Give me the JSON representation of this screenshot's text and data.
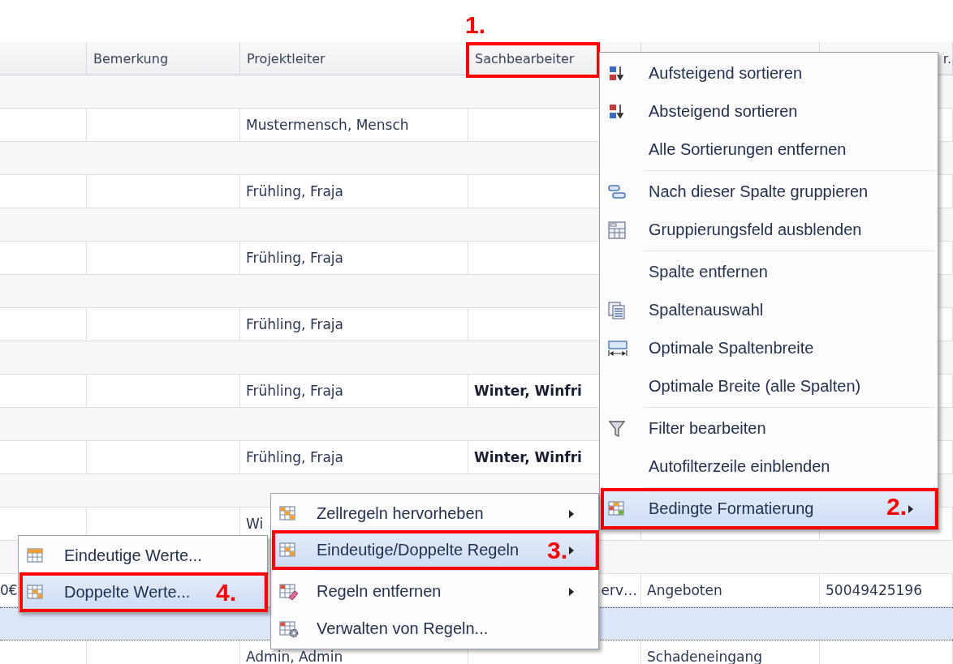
{
  "grid": {
    "columns": [
      {},
      {
        "label": "Bemerkung"
      },
      {
        "label": "Projektleiter"
      },
      {
        "label": "Sachbearbeiter",
        "annotation": "1."
      },
      {},
      {
        "label": "r."
      }
    ],
    "rows": [
      {
        "kind": "group",
        "selected": false
      },
      {
        "kind": "data",
        "selected": false,
        "cells": [
          null,
          null,
          {
            "text": "Mustermensch, Mensch",
            "bold": false
          },
          null,
          null,
          null
        ]
      },
      {
        "kind": "group",
        "selected": false
      },
      {
        "kind": "data",
        "selected": false,
        "cells": [
          null,
          null,
          {
            "text": "Frühling, Fraja",
            "bold": false
          },
          null,
          null,
          null
        ]
      },
      {
        "kind": "group",
        "selected": false
      },
      {
        "kind": "data",
        "selected": false,
        "cells": [
          null,
          null,
          {
            "text": "Frühling, Fraja",
            "bold": false
          },
          null,
          null,
          null
        ]
      },
      {
        "kind": "group",
        "selected": false
      },
      {
        "kind": "data",
        "selected": false,
        "cells": [
          null,
          null,
          {
            "text": "Frühling, Fraja",
            "bold": false
          },
          null,
          null,
          null
        ]
      },
      {
        "kind": "group",
        "selected": false
      },
      {
        "kind": "data",
        "selected": false,
        "cells": [
          null,
          null,
          {
            "text": "Frühling, Fraja",
            "bold": false
          },
          {
            "text": "Winter, Winfri",
            "bold": true
          },
          null,
          null
        ]
      },
      {
        "kind": "group",
        "selected": false
      },
      {
        "kind": "data",
        "selected": false,
        "cells": [
          null,
          null,
          {
            "text": "Frühling, Fraja",
            "bold": false
          },
          {
            "text": "Winter, Winfri",
            "bold": true
          },
          null,
          null
        ]
      },
      {
        "kind": "group",
        "selected": false
      },
      {
        "kind": "data",
        "selected": false,
        "cells": [
          null,
          null,
          {
            "text": "Wi",
            "bold": false
          },
          null,
          null,
          null
        ]
      },
      {
        "kind": "group",
        "selected": false
      },
      {
        "kind": "data",
        "selected": false,
        "cells": [
          {
            "text": "0€",
            "bold": false
          },
          null,
          null,
          {
            "text": "erv…",
            "bold": false,
            "cut_off": true
          },
          {
            "text": "Angeboten",
            "bold": false
          },
          {
            "text": "50049425196",
            "bold": false
          }
        ]
      },
      {
        "kind": "data",
        "selected": true
      },
      {
        "kind": "data",
        "selected": false,
        "cells": [
          null,
          null,
          {
            "text": "Admin, Admin",
            "bold": false
          },
          null,
          {
            "text": "Schadeneingang",
            "bold": false
          },
          null
        ]
      }
    ]
  },
  "context_menu": {
    "items": [
      {
        "label": "Aufsteigend sortieren",
        "selected": false,
        "submenu": false
      },
      {
        "label": "Absteigend sortieren",
        "selected": false,
        "submenu": false
      },
      {
        "label": "Alle Sortierungen entfernen",
        "selected": false,
        "submenu": false
      },
      {
        "label": "Nach dieser Spalte gruppieren",
        "selected": false,
        "submenu": false,
        "separator_before": true
      },
      {
        "label": "Gruppierungsfeld ausblenden",
        "selected": false,
        "submenu": false
      },
      {
        "label": "Spalte entfernen",
        "selected": false,
        "submenu": false,
        "separator_before": true
      },
      {
        "label": "Spaltenauswahl",
        "selected": false,
        "submenu": false
      },
      {
        "label": "Optimale Spaltenbreite",
        "selected": false,
        "submenu": false
      },
      {
        "label": "Optimale Breite (alle Spalten)",
        "selected": false,
        "submenu": false
      },
      {
        "label": "Filter bearbeiten",
        "selected": false,
        "submenu": false,
        "separator_before": true
      },
      {
        "label": "Autofilterzeile einblenden",
        "selected": false,
        "submenu": false
      },
      {
        "label": "Bedingte Formatierung",
        "selected": true,
        "submenu": true,
        "separator_before": true,
        "annotation": "2."
      }
    ]
  },
  "submenu": {
    "items": [
      {
        "label": "Zellregeln hervorheben",
        "selected": false,
        "submenu": true
      },
      {
        "label": "Eindeutige/Doppelte Regeln",
        "selected": true,
        "submenu": true,
        "annotation": "3."
      },
      {
        "label": "Regeln entfernen",
        "selected": false,
        "submenu": true,
        "separator_before": true
      },
      {
        "label": "Verwalten von Regeln...",
        "selected": false,
        "submenu": false
      }
    ]
  },
  "submenu_2": {
    "items": [
      {
        "label": "Eindeutige Werte...",
        "selected": false
      },
      {
        "label": "Doppelte Werte...",
        "selected": true,
        "annotation": "4."
      }
    ]
  }
}
